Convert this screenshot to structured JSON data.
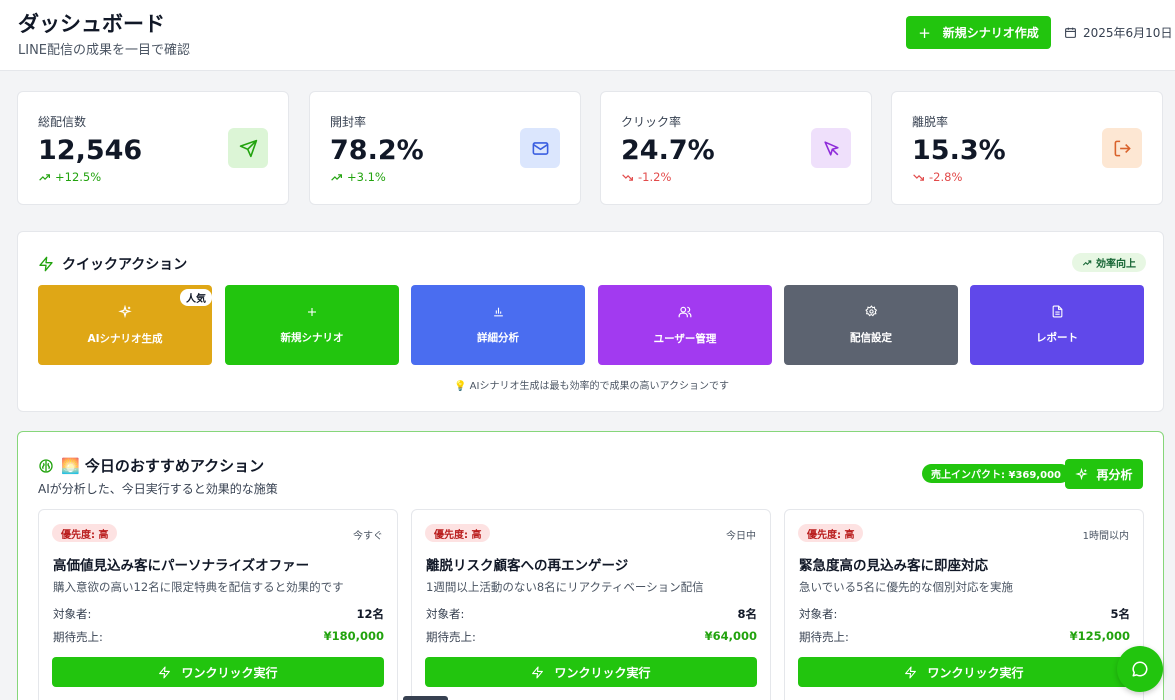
{
  "header": {
    "title": "ダッシュボード",
    "subtitle": "LINE配信の成果を一目で確認",
    "new_scenario_label": "新規シナリオ作成",
    "date": "2025年6月10日"
  },
  "stats": [
    {
      "label": "総配信数",
      "value": "12,546",
      "change": "+12.5%",
      "trend": "up",
      "icon": "send-icon",
      "icon_bg": "#dcf5d6",
      "icon_color": "#22a30e"
    },
    {
      "label": "開封率",
      "value": "78.2%",
      "change": "+3.1%",
      "trend": "up",
      "icon": "mail-icon",
      "icon_bg": "#dbe6fd",
      "icon_color": "#3b5fe0"
    },
    {
      "label": "クリック率",
      "value": "24.7%",
      "change": "-1.2%",
      "trend": "down",
      "icon": "cursor-icon",
      "icon_bg": "#efe0fb",
      "icon_color": "#8e2bd9"
    },
    {
      "label": "離脱率",
      "value": "15.3%",
      "change": "-2.8%",
      "trend": "down",
      "icon": "logout-icon",
      "icon_bg": "#fde7d3",
      "icon_color": "#d9622b"
    }
  ],
  "quick_actions": {
    "title": "クイックアクション",
    "badge": "効率向上",
    "tiles": [
      {
        "label": "AIシナリオ生成",
        "icon": "sparkles-icon",
        "color": "#dfa716",
        "tag": "人気"
      },
      {
        "label": "新規シナリオ",
        "icon": "plus-icon",
        "color": "#22c50e"
      },
      {
        "label": "詳細分析",
        "icon": "bar-chart-icon",
        "color": "#4a6df0"
      },
      {
        "label": "ユーザー管理",
        "icon": "users-icon",
        "color": "#a23af0"
      },
      {
        "label": "配信設定",
        "icon": "gear-icon",
        "color": "#5c6370"
      },
      {
        "label": "レポート",
        "icon": "document-icon",
        "color": "#6048ea"
      }
    ],
    "tip": "💡 AIシナリオ生成は最も効率的で成果の高いアクションです"
  },
  "recommendations": {
    "title": "🌅 今日のおすすめアクション",
    "subtitle": "AIが分析した、今日実行すると効果的な施策",
    "impact": "売上インパクト: ¥369,000",
    "reanalyze_label": "再分析",
    "target_label": "対象者:",
    "revenue_label": "期待売上:",
    "exec_label": "ワンクリック実行",
    "cards": [
      {
        "priority": "優先度: 高",
        "timing": "今すぐ",
        "title": "高価値見込み客にパーソナライズオファー",
        "desc": "購入意欲の高い12名に限定特典を配信すると効果的です",
        "target": "12名",
        "revenue": "¥180,000"
      },
      {
        "priority": "優先度: 高",
        "timing": "今日中",
        "title": "離脱リスク顧客への再エンゲージ",
        "desc": "1週間以上活動のない8名にリアクティベーション配信",
        "target": "8名",
        "revenue": "¥64,000"
      },
      {
        "priority": "優先度: 高",
        "timing": "1時間以内",
        "title": "緊急度高の見込み客に即座対応",
        "desc": "急いでいる5名に優先的な個別対応を実施",
        "target": "5名",
        "revenue": "¥125,000"
      }
    ]
  }
}
